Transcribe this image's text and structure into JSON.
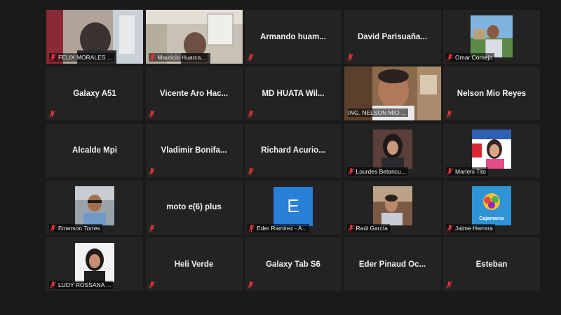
{
  "meeting": {
    "tiles": [
      {
        "name": "FELIX MORALES ...",
        "type": "video"
      },
      {
        "name": "Mauricio Huarca...",
        "type": "video"
      },
      {
        "name": "Armando  huam...",
        "type": "name"
      },
      {
        "name": "David  Parisuaña...",
        "type": "name"
      },
      {
        "name": "Omar Cornejo",
        "type": "photo"
      },
      {
        "name": "Galaxy A51",
        "type": "name"
      },
      {
        "name": "Vicente  Aro  Hac...",
        "type": "name"
      },
      {
        "name": "MD HUATA  Wil...",
        "type": "name"
      },
      {
        "name": "ING. NELSON MIO ...",
        "type": "video",
        "active": true
      },
      {
        "name": "Nelson Mio Reyes",
        "type": "name"
      },
      {
        "name": "Alcalde Mpi",
        "type": "name"
      },
      {
        "name": "Vladimir  Bonifa...",
        "type": "name"
      },
      {
        "name": "Richard  Acurio...",
        "type": "name"
      },
      {
        "name": "Lourdes Betancu...",
        "type": "photo"
      },
      {
        "name": "Marleni Tito",
        "type": "photo"
      },
      {
        "name": "Emerson Torres",
        "type": "photo"
      },
      {
        "name": "moto e(6) plus",
        "type": "name"
      },
      {
        "name": "Eder Ramirez - A...",
        "type": "letter",
        "letter": "E"
      },
      {
        "name": "Raúl García",
        "type": "photo"
      },
      {
        "name": "Jaime Herrera",
        "type": "photo",
        "logo_text": "Cajamarca"
      },
      {
        "name": "LUDY ROSSANA ...",
        "type": "photo"
      },
      {
        "name": "Heli Verde",
        "type": "name"
      },
      {
        "name": "Galaxy Tab S6",
        "type": "name"
      },
      {
        "name": "Eder  Pinaud  Oc...",
        "type": "name"
      },
      {
        "name": "Esteban",
        "type": "name"
      }
    ]
  },
  "colors": {
    "background": "#1a1a1a",
    "tile": "#232323",
    "active_border": "#b9d74a",
    "muted_mic": "#e0333a"
  },
  "icons": {
    "muted": "muted-mic-icon"
  }
}
